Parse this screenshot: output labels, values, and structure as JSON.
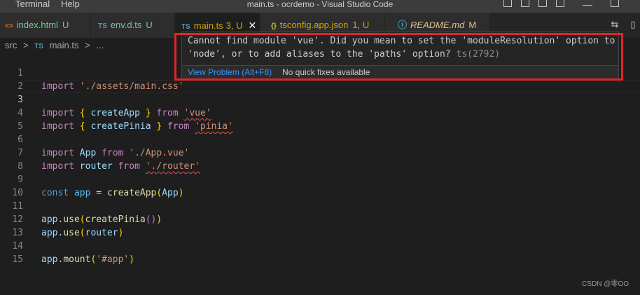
{
  "titlebar": {
    "menu": [
      "Terminal",
      "Help"
    ],
    "title": "main.ts - ocrdemo - Visual Studio Code"
  },
  "tabs": [
    {
      "icon": "<>",
      "name": "index.html",
      "status": "U",
      "active": false
    },
    {
      "icon": "TS",
      "name": "env.d.ts",
      "status": "U",
      "active": false
    },
    {
      "icon": "TS",
      "name": "main.ts",
      "status": "3, U",
      "active": true
    },
    {
      "icon": "{}",
      "name": "tsconfig.app.json",
      "status": "1, U",
      "active": false
    },
    {
      "icon": "ⓘ",
      "name": "README.md",
      "status": "M",
      "active": false
    }
  ],
  "breadcrumb": {
    "folder": "src",
    "sep": ">",
    "file_icon": "TS",
    "file": "main.ts",
    "tail": "..."
  },
  "editor": {
    "current_line": 3,
    "lines": [
      {
        "n": "1"
      },
      {
        "n": "2"
      },
      {
        "n": "3"
      },
      {
        "n": "4"
      },
      {
        "n": "5"
      },
      {
        "n": "6"
      },
      {
        "n": "7"
      },
      {
        "n": "8"
      },
      {
        "n": "9"
      },
      {
        "n": "10"
      },
      {
        "n": "11"
      },
      {
        "n": "12"
      },
      {
        "n": "13"
      },
      {
        "n": "14"
      },
      {
        "n": "15"
      }
    ],
    "code": {
      "l1_kw": "import",
      "l1_str": "'./assets/main.css'",
      "l3_kw": "import",
      "l3_open": "{",
      "l3_fn": "createApp",
      "l3_close": "}",
      "l3_from": "from",
      "l3_str": "'vue'",
      "l4_kw": "import",
      "l4_open": "{",
      "l4_fn": "createPinia",
      "l4_close": "}",
      "l4_from": "from",
      "l4_str": "'pinia'",
      "l6_kw": "import",
      "l6_var": "App",
      "l6_from": "from",
      "l6_str": "'./App.vue'",
      "l7_kw": "import",
      "l7_var": "router",
      "l7_from": "from",
      "l7_str": "'./router'",
      "l9_kw": "const",
      "l9_var": "app",
      "l9_eq": "=",
      "l9_fn": "createApp",
      "l9_open": "(",
      "l9_arg": "App",
      "l9_close": ")",
      "l11_obj": "app",
      "l11_dot": ".",
      "l11_fn": "use",
      "l11_open": "(",
      "l11_arg": "createPinia",
      "l11_inner": "()",
      "l11_close": ")",
      "l12_obj": "app",
      "l12_dot": ".",
      "l12_fn": "use",
      "l12_open": "(",
      "l12_arg": "router",
      "l12_close": ")",
      "l14_obj": "app",
      "l14_dot": ".",
      "l14_fn": "mount",
      "l14_open": "(",
      "l14_str": "'#app'",
      "l14_close": ")"
    }
  },
  "hover": {
    "message_line1": "Cannot find module 'vue'. Did you mean to set the 'moduleResolution' option to",
    "message_line2": "'node', or to add aliases to the 'paths' option?",
    "code": "ts(2792)",
    "view_problem": "View Problem (Alt+F8)",
    "no_fixes": "No quick fixes available"
  },
  "watermark": "CSDN @零OO",
  "colors": {
    "highlight_border": "#e0242a",
    "link": "#3794ff",
    "untracked": "#73c991",
    "modified_warning": "#cca700"
  }
}
